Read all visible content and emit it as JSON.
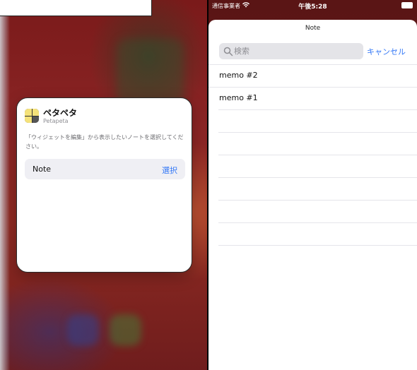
{
  "left_panel": {
    "widget": {
      "app_name": "ペタペタ",
      "app_subtitle": "Petapeta",
      "description": "「ウィジェットを編集」から表示したいノートを選択してください。",
      "parameter": {
        "label": "Note",
        "value": "選択"
      }
    }
  },
  "right_panel": {
    "status_bar": {
      "carrier": "通信事業者",
      "time": "午後5:28"
    },
    "sheet": {
      "title": "Note",
      "search_placeholder": "検索",
      "cancel_label": "キャンセル",
      "items": [
        {
          "label": "memo #2"
        },
        {
          "label": "memo #1"
        }
      ],
      "empty_rows": 7
    }
  },
  "colors": {
    "accent": "#3478f6",
    "wallpaper": "#8b2525",
    "app_icon_yellow": "#f5e27a"
  }
}
